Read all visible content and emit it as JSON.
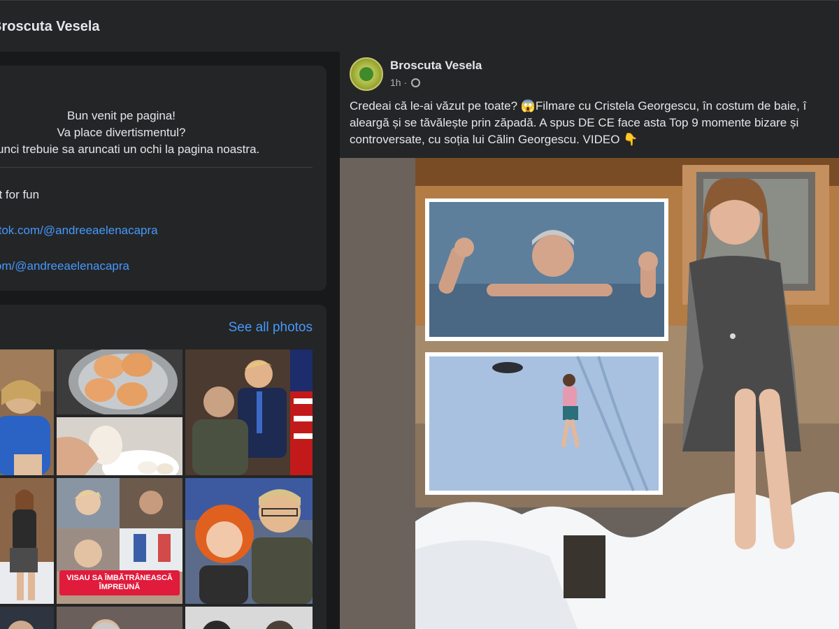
{
  "header": {
    "page_name": "Broscuta Vesela"
  },
  "intro": {
    "bio_lines": [
      "Bun venit pe pagina!",
      "Va place divertismentul?",
      "Atunci trebuie sa aruncati un ochi la pagina noastra."
    ],
    "details": {
      "category": "Just for fun",
      "tiktok_link": "www.tiktok.com/@andreeaelenacapra",
      "other_link": "tiktok.com/@andreeaelenacapra"
    }
  },
  "photos": {
    "see_all_label": "See all photos",
    "tiles": [
      {
        "name": "photo-woman-blue"
      },
      {
        "name": "photo-eggs"
      },
      {
        "name": "photo-politicians"
      },
      {
        "name": "photo-woman-couple",
        "caption": "VISAU SA ÎMBĂTRÂNEASCĂ ÎMPREUNĂ"
      },
      {
        "name": "photo-couple-smiling"
      }
    ]
  },
  "post": {
    "author": "Broscuta Vesela",
    "time": "1h ·",
    "text_lines": [
      "Credeai că le-ai văzut pe toate? 😱Filmare cu Cristela Georgescu, în costum de baie, î",
      "aleargă și se tăvălește prin zăpadă. A spus DE CE face asta Top 9 momente bizare și",
      "controversate, cu soția lui Călin Georgescu. VIDEO 👇"
    ]
  },
  "colors": {
    "background": "#18191a",
    "card": "#242526",
    "link": "#4599ff",
    "text": "#e4e6eb",
    "muted": "#b0b3b8",
    "caption_banner": "#e01b3c"
  },
  "icons": [
    "globe-icon",
    "page-avatar-icon"
  ]
}
